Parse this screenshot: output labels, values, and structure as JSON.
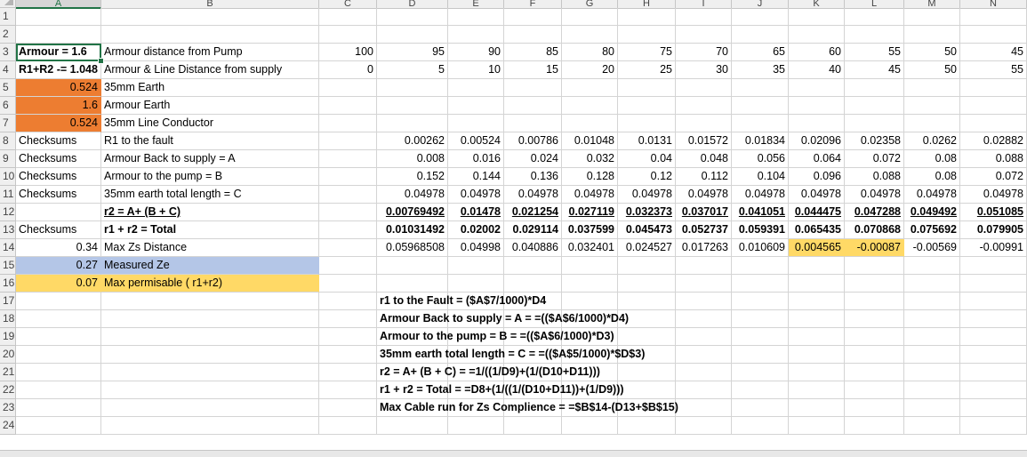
{
  "columns": [
    "A",
    "B",
    "C",
    "D",
    "E",
    "F",
    "G",
    "H",
    "I",
    "J",
    "K",
    "L",
    "M",
    "N"
  ],
  "selected_column": "A",
  "colors": {
    "orange_fill": "#ed7d31",
    "blue_fill": "#b4c6e7",
    "yellow_fill": "#ffd966",
    "selection": "#217346"
  },
  "rows": [
    {
      "n": "1",
      "cells": {}
    },
    {
      "n": "2",
      "cells": {}
    },
    {
      "n": "3",
      "cells": {
        "A": {
          "v": "Armour = 1.6",
          "bold": true,
          "align": "left",
          "selected": true
        },
        "B": {
          "v": "Armour distance from Pump"
        },
        "C": {
          "v": "100",
          "num": true
        },
        "D": {
          "v": "95",
          "num": true
        },
        "E": {
          "v": "90",
          "num": true
        },
        "F": {
          "v": "85",
          "num": true
        },
        "G": {
          "v": "80",
          "num": true
        },
        "H": {
          "v": "75",
          "num": true
        },
        "I": {
          "v": "70",
          "num": true
        },
        "J": {
          "v": "65",
          "num": true
        },
        "K": {
          "v": "60",
          "num": true
        },
        "L": {
          "v": "55",
          "num": true
        },
        "M": {
          "v": "50",
          "num": true
        },
        "N": {
          "v": "45",
          "num": true
        }
      }
    },
    {
      "n": "4",
      "cells": {
        "A": {
          "v": "R1+R2 -= 1.048",
          "bold": true,
          "align": "left"
        },
        "B": {
          "v": "Armour & Line Distance from supply"
        },
        "C": {
          "v": "0",
          "num": true
        },
        "D": {
          "v": "5",
          "num": true
        },
        "E": {
          "v": "10",
          "num": true
        },
        "F": {
          "v": "15",
          "num": true
        },
        "G": {
          "v": "20",
          "num": true
        },
        "H": {
          "v": "25",
          "num": true
        },
        "I": {
          "v": "30",
          "num": true
        },
        "J": {
          "v": "35",
          "num": true
        },
        "K": {
          "v": "40",
          "num": true
        },
        "L": {
          "v": "45",
          "num": true
        },
        "M": {
          "v": "50",
          "num": true
        },
        "N": {
          "v": "55",
          "num": true
        }
      }
    },
    {
      "n": "5",
      "cells": {
        "A": {
          "v": "0.524",
          "num": true,
          "fill": "orange"
        },
        "B": {
          "v": "35mm Earth"
        }
      }
    },
    {
      "n": "6",
      "cells": {
        "A": {
          "v": "1.6",
          "num": true,
          "fill": "orange"
        },
        "B": {
          "v": "Armour Earth"
        }
      }
    },
    {
      "n": "7",
      "cells": {
        "A": {
          "v": "0.524",
          "num": true,
          "fill": "orange"
        },
        "B": {
          "v": "35mm Line Conductor"
        }
      }
    },
    {
      "n": "8",
      "cells": {
        "A": {
          "v": "Checksums"
        },
        "B": {
          "v": "R1 to the fault"
        },
        "D": {
          "v": "0.00262",
          "num": true
        },
        "E": {
          "v": "0.00524",
          "num": true
        },
        "F": {
          "v": "0.00786",
          "num": true
        },
        "G": {
          "v": "0.01048",
          "num": true
        },
        "H": {
          "v": "0.0131",
          "num": true
        },
        "I": {
          "v": "0.01572",
          "num": true
        },
        "J": {
          "v": "0.01834",
          "num": true
        },
        "K": {
          "v": "0.02096",
          "num": true
        },
        "L": {
          "v": "0.02358",
          "num": true
        },
        "M": {
          "v": "0.0262",
          "num": true
        },
        "N": {
          "v": "0.02882",
          "num": true
        }
      }
    },
    {
      "n": "9",
      "cells": {
        "A": {
          "v": "Checksums"
        },
        "B": {
          "v": "Armour Back to supply = A"
        },
        "D": {
          "v": "0.008",
          "num": true
        },
        "E": {
          "v": "0.016",
          "num": true
        },
        "F": {
          "v": "0.024",
          "num": true
        },
        "G": {
          "v": "0.032",
          "num": true
        },
        "H": {
          "v": "0.04",
          "num": true
        },
        "I": {
          "v": "0.048",
          "num": true
        },
        "J": {
          "v": "0.056",
          "num": true
        },
        "K": {
          "v": "0.064",
          "num": true
        },
        "L": {
          "v": "0.072",
          "num": true
        },
        "M": {
          "v": "0.08",
          "num": true
        },
        "N": {
          "v": "0.088",
          "num": true
        }
      }
    },
    {
      "n": "10",
      "cells": {
        "A": {
          "v": "Checksums"
        },
        "B": {
          "v": "Armour to the pump = B"
        },
        "D": {
          "v": "0.152",
          "num": true
        },
        "E": {
          "v": "0.144",
          "num": true
        },
        "F": {
          "v": "0.136",
          "num": true
        },
        "G": {
          "v": "0.128",
          "num": true
        },
        "H": {
          "v": "0.12",
          "num": true
        },
        "I": {
          "v": "0.112",
          "num": true
        },
        "J": {
          "v": "0.104",
          "num": true
        },
        "K": {
          "v": "0.096",
          "num": true
        },
        "L": {
          "v": "0.088",
          "num": true
        },
        "M": {
          "v": "0.08",
          "num": true
        },
        "N": {
          "v": "0.072",
          "num": true
        }
      }
    },
    {
      "n": "11",
      "cells": {
        "A": {
          "v": "Checksums"
        },
        "B": {
          "v": "35mm earth total length = C"
        },
        "D": {
          "v": "0.04978",
          "num": true
        },
        "E": {
          "v": "0.04978",
          "num": true
        },
        "F": {
          "v": "0.04978",
          "num": true
        },
        "G": {
          "v": "0.04978",
          "num": true
        },
        "H": {
          "v": "0.04978",
          "num": true
        },
        "I": {
          "v": "0.04978",
          "num": true
        },
        "J": {
          "v": "0.04978",
          "num": true
        },
        "K": {
          "v": "0.04978",
          "num": true
        },
        "L": {
          "v": "0.04978",
          "num": true
        },
        "M": {
          "v": "0.04978",
          "num": true
        },
        "N": {
          "v": "0.04978",
          "num": true
        }
      }
    },
    {
      "n": "12",
      "cells": {
        "B": {
          "v": "r2 = A+ (B + C)",
          "bold": true,
          "ul": true
        },
        "D": {
          "v": "0.00769492",
          "num": true,
          "bold": true,
          "ul": true
        },
        "E": {
          "v": "0.01478",
          "num": true,
          "bold": true,
          "ul": true
        },
        "F": {
          "v": "0.021254",
          "num": true,
          "bold": true,
          "ul": true
        },
        "G": {
          "v": "0.027119",
          "num": true,
          "bold": true,
          "ul": true
        },
        "H": {
          "v": "0.032373",
          "num": true,
          "bold": true,
          "ul": true
        },
        "I": {
          "v": "0.037017",
          "num": true,
          "bold": true,
          "ul": true
        },
        "J": {
          "v": "0.041051",
          "num": true,
          "bold": true,
          "ul": true
        },
        "K": {
          "v": "0.044475",
          "num": true,
          "bold": true,
          "ul": true
        },
        "L": {
          "v": "0.047288",
          "num": true,
          "bold": true,
          "ul": true
        },
        "M": {
          "v": "0.049492",
          "num": true,
          "bold": true,
          "ul": true
        },
        "N": {
          "v": "0.051085",
          "num": true,
          "bold": true,
          "ul": true
        }
      }
    },
    {
      "n": "13",
      "cells": {
        "A": {
          "v": "Checksums"
        },
        "B": {
          "v": "r1 + r2 = Total",
          "bold": true
        },
        "D": {
          "v": "0.01031492",
          "num": true,
          "bold": true
        },
        "E": {
          "v": "0.02002",
          "num": true,
          "bold": true
        },
        "F": {
          "v": "0.029114",
          "num": true,
          "bold": true
        },
        "G": {
          "v": "0.037599",
          "num": true,
          "bold": true
        },
        "H": {
          "v": "0.045473",
          "num": true,
          "bold": true
        },
        "I": {
          "v": "0.052737",
          "num": true,
          "bold": true
        },
        "J": {
          "v": "0.059391",
          "num": true,
          "bold": true
        },
        "K": {
          "v": "0.065435",
          "num": true,
          "bold": true
        },
        "L": {
          "v": "0.070868",
          "num": true,
          "bold": true
        },
        "M": {
          "v": "0.075692",
          "num": true,
          "bold": true
        },
        "N": {
          "v": "0.079905",
          "num": true,
          "bold": true
        }
      }
    },
    {
      "n": "14",
      "cells": {
        "A": {
          "v": "0.34",
          "num": true
        },
        "B": {
          "v": "Max Zs Distance"
        },
        "D": {
          "v": "0.05968508",
          "num": true
        },
        "E": {
          "v": "0.04998",
          "num": true
        },
        "F": {
          "v": "0.040886",
          "num": true
        },
        "G": {
          "v": "0.032401",
          "num": true
        },
        "H": {
          "v": "0.024527",
          "num": true
        },
        "I": {
          "v": "0.017263",
          "num": true
        },
        "J": {
          "v": "0.010609",
          "num": true
        },
        "K": {
          "v": "0.004565",
          "num": true,
          "fill": "yellow"
        },
        "L": {
          "v": "-0.00087",
          "num": true,
          "fill": "yellow"
        },
        "M": {
          "v": "-0.00569",
          "num": true
        },
        "N": {
          "v": "-0.00991",
          "num": true
        }
      }
    },
    {
      "n": "15",
      "cells": {
        "A": {
          "v": "0.27",
          "num": true,
          "fill": "blue"
        },
        "B": {
          "v": "Measured Ze",
          "fill": "blue"
        }
      }
    },
    {
      "n": "16",
      "cells": {
        "A": {
          "v": "0.07",
          "num": true,
          "fill": "yellow"
        },
        "B": {
          "v": "Max permisable ( r1+r2)",
          "fill": "yellow"
        }
      }
    },
    {
      "n": "17",
      "cells": {
        "D": {
          "v": "r1 to the Fault = ($A$7/1000)*D4",
          "bold": true
        }
      }
    },
    {
      "n": "18",
      "cells": {
        "D": {
          "v": "Armour Back to supply = A = =(($A$6/1000)*D4)",
          "bold": true
        }
      }
    },
    {
      "n": "19",
      "cells": {
        "D": {
          "v": "Armour to the pump = B = =(($A$6/1000)*D3)",
          "bold": true
        }
      }
    },
    {
      "n": "20",
      "cells": {
        "D": {
          "v": "35mm earth total length = C = =(($A$5/1000)*$D$3)",
          "bold": true
        }
      }
    },
    {
      "n": "21",
      "cells": {
        "D": {
          "v": "r2 = A+ (B + C) = =1/((1/D9)+(1/(D10+D11)))",
          "bold": true
        }
      }
    },
    {
      "n": "22",
      "cells": {
        "D": {
          "v": "r1 + r2 = Total = =D8+(1/((1/(D10+D11))+(1/D9)))",
          "bold": true
        }
      }
    },
    {
      "n": "23",
      "cells": {
        "D": {
          "v": "Max Cable run for Zs Complience = =$B$14-(D13+$B$15)",
          "bold": true
        }
      }
    },
    {
      "n": "24",
      "cells": {}
    }
  ]
}
